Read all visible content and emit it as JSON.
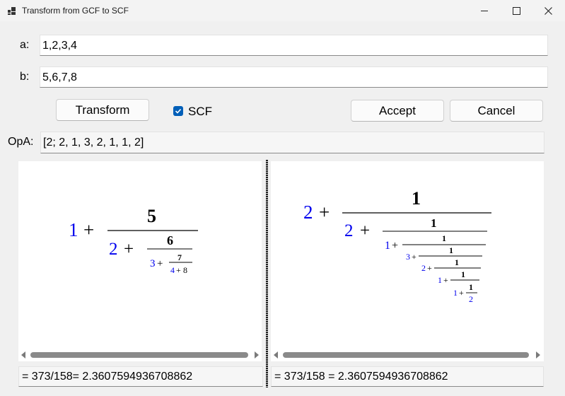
{
  "window": {
    "title": "Transform from GCF to SCF"
  },
  "inputs": {
    "a_label": "a:",
    "a_value": "1,2,3,4",
    "b_label": "b:",
    "b_value": "5,6,7,8"
  },
  "buttons": {
    "transform": "Transform",
    "accept": "Accept",
    "cancel": "Cancel"
  },
  "scf_checkbox": {
    "label": "SCF",
    "checked": true
  },
  "opa": {
    "label": "OpA:",
    "value": "[2; 2, 1, 3, 2, 1, 1, 2]"
  },
  "formula_left": {
    "a": [
      "1",
      "2",
      "3",
      "4"
    ],
    "b": [
      "5",
      "6",
      "7",
      "8"
    ],
    "plus": "+"
  },
  "formula_right": {
    "a": [
      "2",
      "2",
      "1",
      "3",
      "2",
      "1",
      "1",
      "2"
    ],
    "b": [
      "1",
      "1",
      "1",
      "1",
      "1",
      "1",
      "1",
      "1"
    ],
    "plus": "+"
  },
  "results": {
    "left": "= 373/158= 2.3607594936708862",
    "right": "= 373/158 = 2.3607594936708862"
  },
  "colors": {
    "partial_quotient": "#0000ee",
    "numerator": "#000000",
    "accent": "#005fb8"
  }
}
